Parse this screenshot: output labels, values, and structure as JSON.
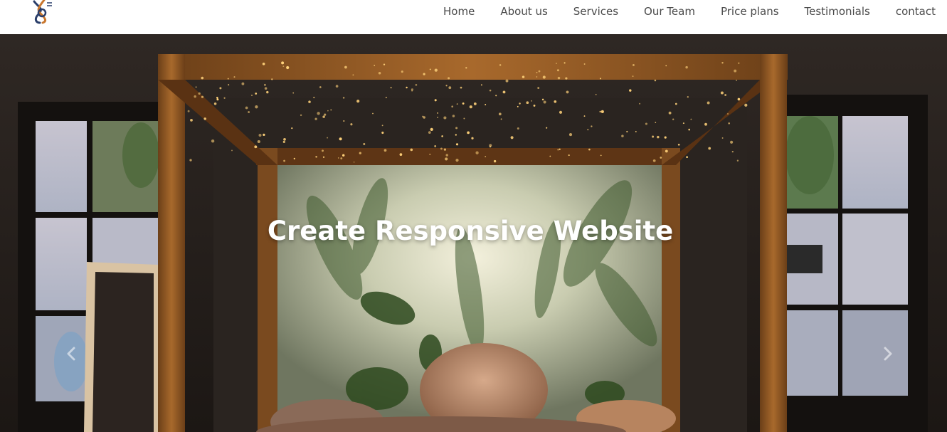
{
  "brand": {
    "logo_icon": "knot-logo-icon"
  },
  "nav": {
    "items": [
      {
        "label": "Home"
      },
      {
        "label": "About us"
      },
      {
        "label": "Services"
      },
      {
        "label": "Our Team"
      },
      {
        "label": "Price plans"
      },
      {
        "label": "Testimonials"
      },
      {
        "label": "contact"
      }
    ],
    "text_color": "#4a4a4a"
  },
  "hero": {
    "title": "Create Responsive Website",
    "controls": {
      "prev_icon": "chevron-left-icon",
      "next_icon": "chevron-right-icon"
    }
  }
}
